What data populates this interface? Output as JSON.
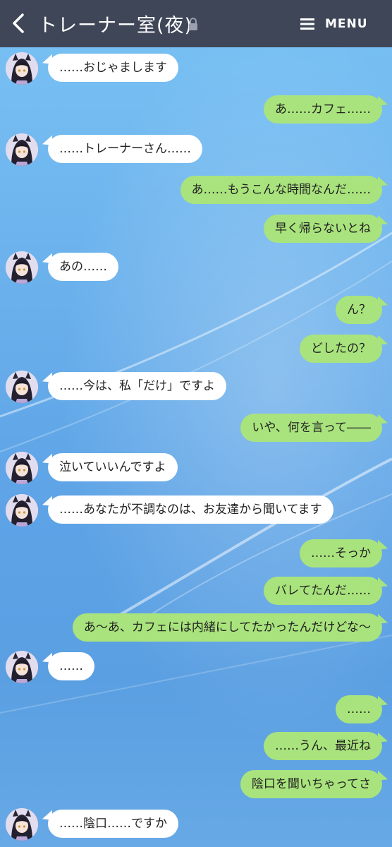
{
  "header": {
    "title": "トレーナー室(夜)",
    "menu_label": "MENU",
    "back_icon": "chevron-left-icon",
    "lock_icon": "lock-icon",
    "menu_icon": "hamburger-icon",
    "bg_color": "#3f4658"
  },
  "colors": {
    "incoming_bubble": "#ffffff",
    "outgoing_bubble": "#a9e37d",
    "background": "#6fb6ee"
  },
  "messages": [
    {
      "side": "in",
      "text": "……おじゃまします"
    },
    {
      "side": "out",
      "text": "あ……カフェ……"
    },
    {
      "side": "in",
      "text": "……トレーナーさん……"
    },
    {
      "side": "out",
      "text": "あ……もうこんな時間なんだ……"
    },
    {
      "side": "out",
      "text": "早く帰らないとね"
    },
    {
      "side": "in",
      "text": "あの……"
    },
    {
      "side": "out",
      "text": "ん？"
    },
    {
      "side": "out",
      "text": "どしたの？"
    },
    {
      "side": "in",
      "text": "……今は、私「だけ」ですよ"
    },
    {
      "side": "out",
      "text": "いや、何を言って――"
    },
    {
      "side": "in",
      "text": "泣いていいんですよ"
    },
    {
      "side": "in",
      "text": "……あなたが不調なのは、お友達から聞いてます"
    },
    {
      "side": "out",
      "text": "……そっか"
    },
    {
      "side": "out",
      "text": "バレてたんだ……"
    },
    {
      "side": "out",
      "text": "あ～あ、カフェには内緒にしてたかったんだけどな～"
    },
    {
      "side": "in",
      "text": "……"
    },
    {
      "side": "out",
      "text": "……"
    },
    {
      "side": "out",
      "text": "……うん、最近ね"
    },
    {
      "side": "out",
      "text": "陰口を聞いちゃってさ"
    },
    {
      "side": "in",
      "text": "……陰口……ですか"
    }
  ]
}
